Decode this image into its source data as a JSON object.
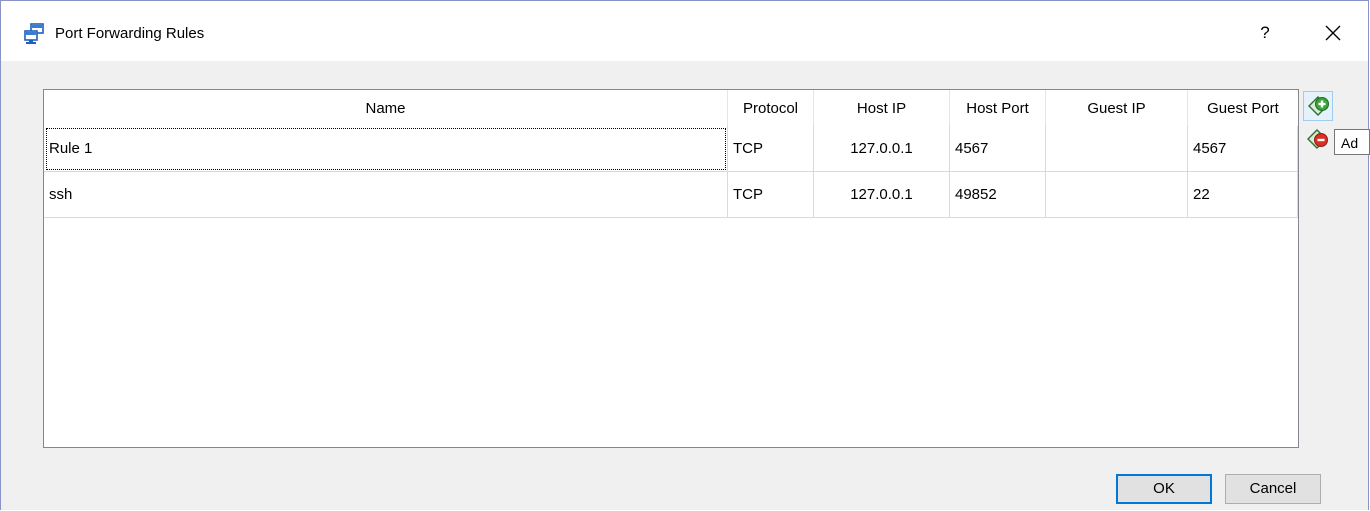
{
  "window": {
    "title": "Port Forwarding Rules",
    "help_label": "?"
  },
  "table": {
    "columns": [
      "Name",
      "Protocol",
      "Host IP",
      "Host Port",
      "Guest IP",
      "Guest Port"
    ],
    "rows": [
      {
        "name": "Rule 1",
        "protocol": "TCP",
        "host_ip": "127.0.0.1",
        "host_port": "4567",
        "guest_ip": "",
        "guest_port": "4567"
      },
      {
        "name": "ssh",
        "protocol": "TCP",
        "host_ip": "127.0.0.1",
        "host_port": "49852",
        "guest_ip": "",
        "guest_port": "22"
      }
    ]
  },
  "side_tools": {
    "add_icon": "add-rule-icon",
    "remove_icon": "remove-rule-icon",
    "tooltip": "Ad"
  },
  "buttons": {
    "ok": "OK",
    "cancel": "Cancel"
  },
  "colors": {
    "dialog_bg": "#f0f0f0",
    "focus_blue": "#0078d7",
    "add_green": "#3aa53a",
    "remove_red": "#d93025"
  }
}
